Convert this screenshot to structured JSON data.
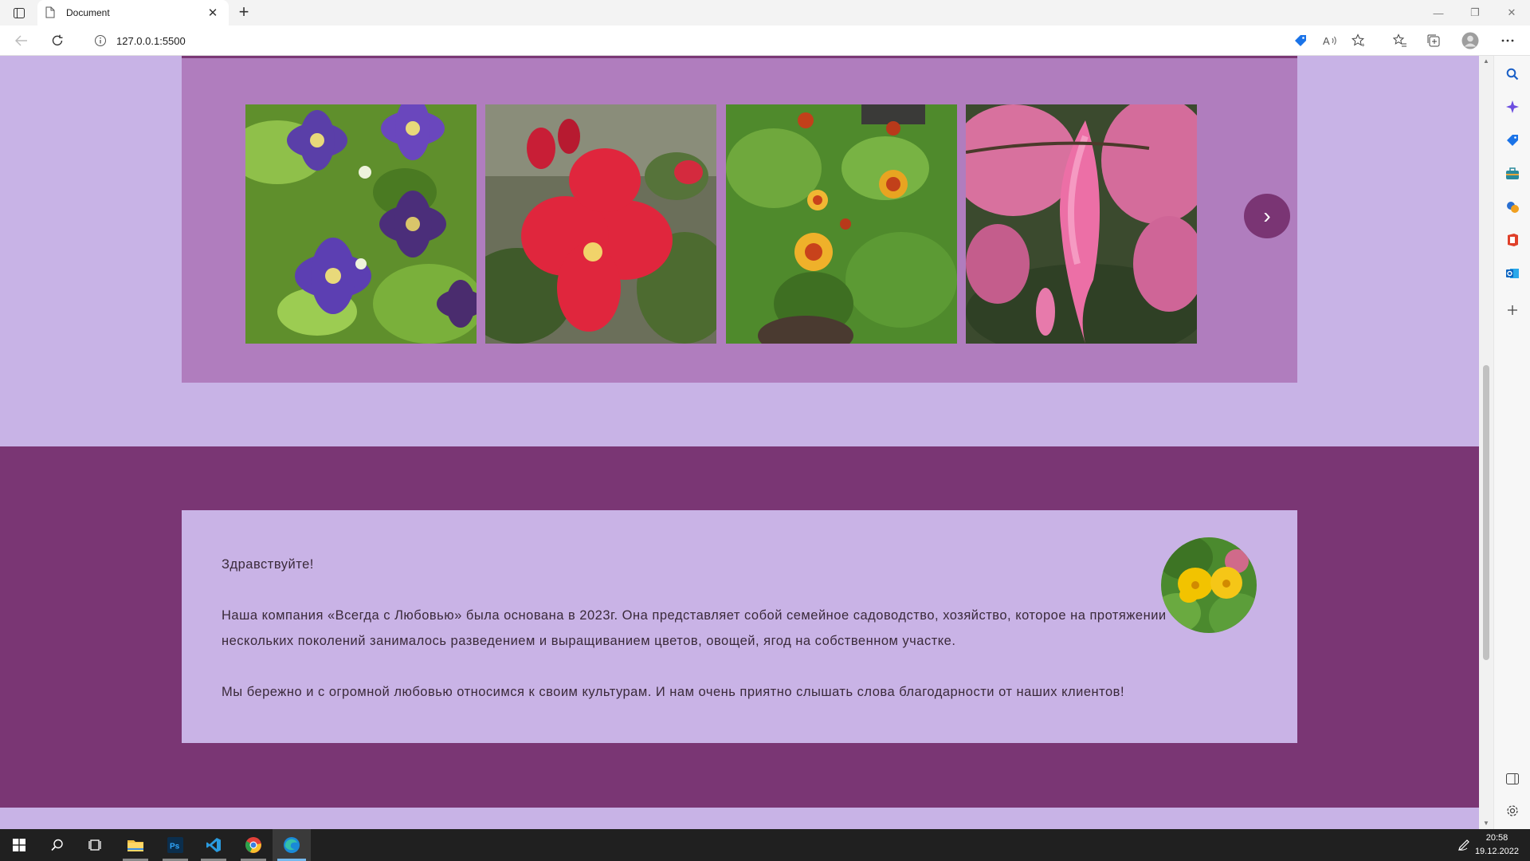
{
  "browser": {
    "tab_title": "Document",
    "url": "127.0.0.1:5500"
  },
  "gallery": {
    "photos": [
      {
        "subject": "purple clematis flowers"
      },
      {
        "subject": "red rose"
      },
      {
        "subject": "orange marigolds"
      },
      {
        "subject": "pink astilbe"
      }
    ],
    "next_label": "›"
  },
  "about": {
    "greeting": "Здравствуйте!",
    "paragraph1": "Наша компания «Всегда с Любовью» была основана в 2023г. Она представляет собой семейное садоводство, хозяйство, которое на протяжении нескольких поколений занималось разведением и выращиванием цветов, овощей, ягод на собственном участке.",
    "paragraph2": "Мы бережно и с огромной любовью относимся к своим культурам. И нам очень приятно слышать слова благодарности от наших клиентов!"
  },
  "taskbar": {
    "time": "20:58",
    "date": "19.12.2022"
  },
  "colors": {
    "page_bg": "#c8b3e6",
    "gallery_bg": "#b07dbe",
    "about_band": "#7a3674",
    "accent": "#7a3574"
  }
}
